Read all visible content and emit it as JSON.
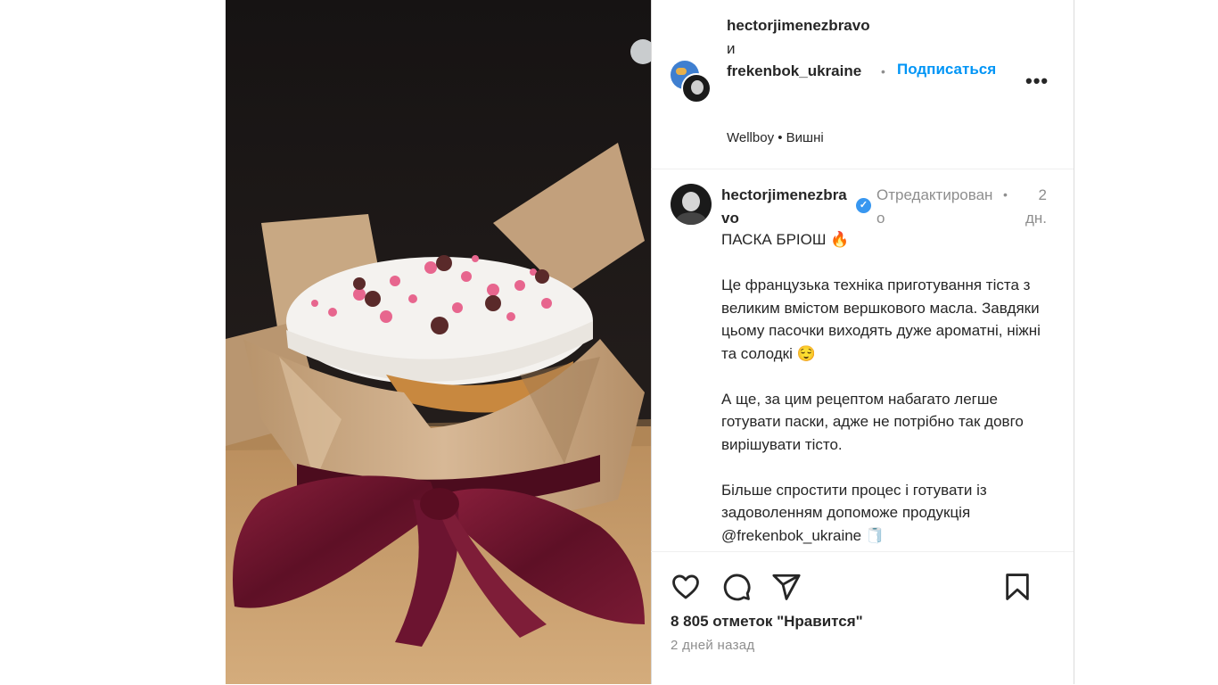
{
  "header": {
    "user1": "hectorjimenezbravo",
    "and_word": "и",
    "user2": "frekenbok_ukraine",
    "audio": "Wellboy • Вишні",
    "dot": "•",
    "follow_label": "Подписаться",
    "more_label": "•••"
  },
  "caption": {
    "username": "hectorjimenezbravo",
    "verified_icon": "verified-badge-icon",
    "edited": "Отредактировано",
    "dot": "•",
    "time": "2 дн.",
    "paragraphs": [
      "ПАСКА БРІОШ 🔥",
      "Це французька техніка приготування тіста з великим вмістом вершкового масла. Завдяки цьому пасочки виходять дуже ароматні, ніжні та солодкі 😌",
      "А ще, за цим рецептом набагато легше готувати паски, адже не потрібно так довго вирішувати тісто.",
      "Більше спростити процес і готувати із задоволенням допоможе продукція @frekenbok_ukraine 🧻"
    ]
  },
  "actions": {
    "icons": [
      "heart-icon",
      "comment-icon",
      "share-icon",
      "bookmark-icon"
    ],
    "likes": "8 805 отметок \"Нравится\"",
    "date": "2 дней назад"
  },
  "colors": {
    "accent": "#0095f6",
    "muted": "#8e8e8e",
    "text": "#262626",
    "ribbon": "#6e1530",
    "paper": "#c9a886"
  }
}
